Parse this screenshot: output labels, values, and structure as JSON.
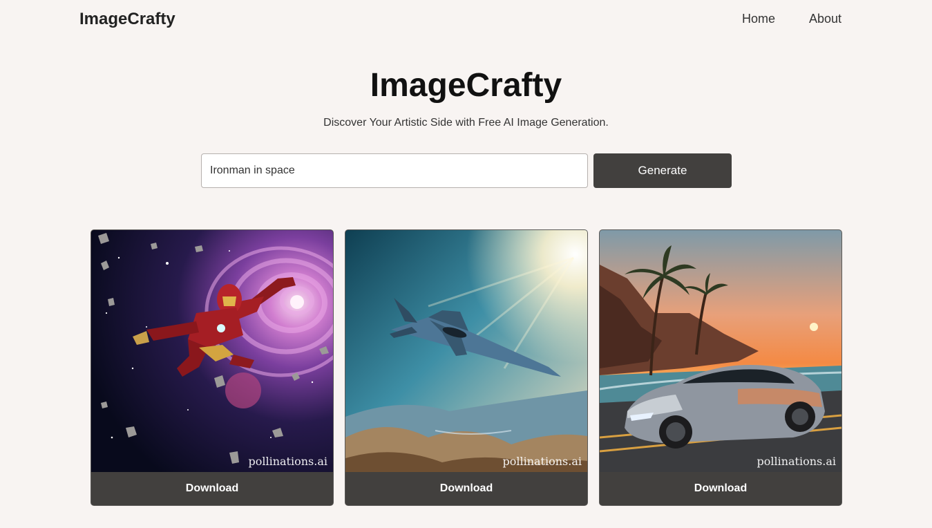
{
  "nav": {
    "brand": "ImageCrafty",
    "links": [
      {
        "label": "Home"
      },
      {
        "label": "About"
      }
    ]
  },
  "hero": {
    "title": "ImageCrafty",
    "subtitle": "Discover Your Artistic Side with Free AI Image Generation."
  },
  "search": {
    "value": "Ironman in space",
    "button_label": "Generate"
  },
  "cards": [
    {
      "image": "ironman-in-space",
      "watermark": "pollinations.ai",
      "button_label": "Download"
    },
    {
      "image": "jet-over-mountains",
      "watermark": "pollinations.ai",
      "button_label": "Download"
    },
    {
      "image": "sports-car-at-sunset",
      "watermark": "pollinations.ai",
      "button_label": "Download"
    }
  ],
  "colors": {
    "background": "#f8f4f2",
    "button": "#42403e",
    "button_text": "#ffffff"
  }
}
